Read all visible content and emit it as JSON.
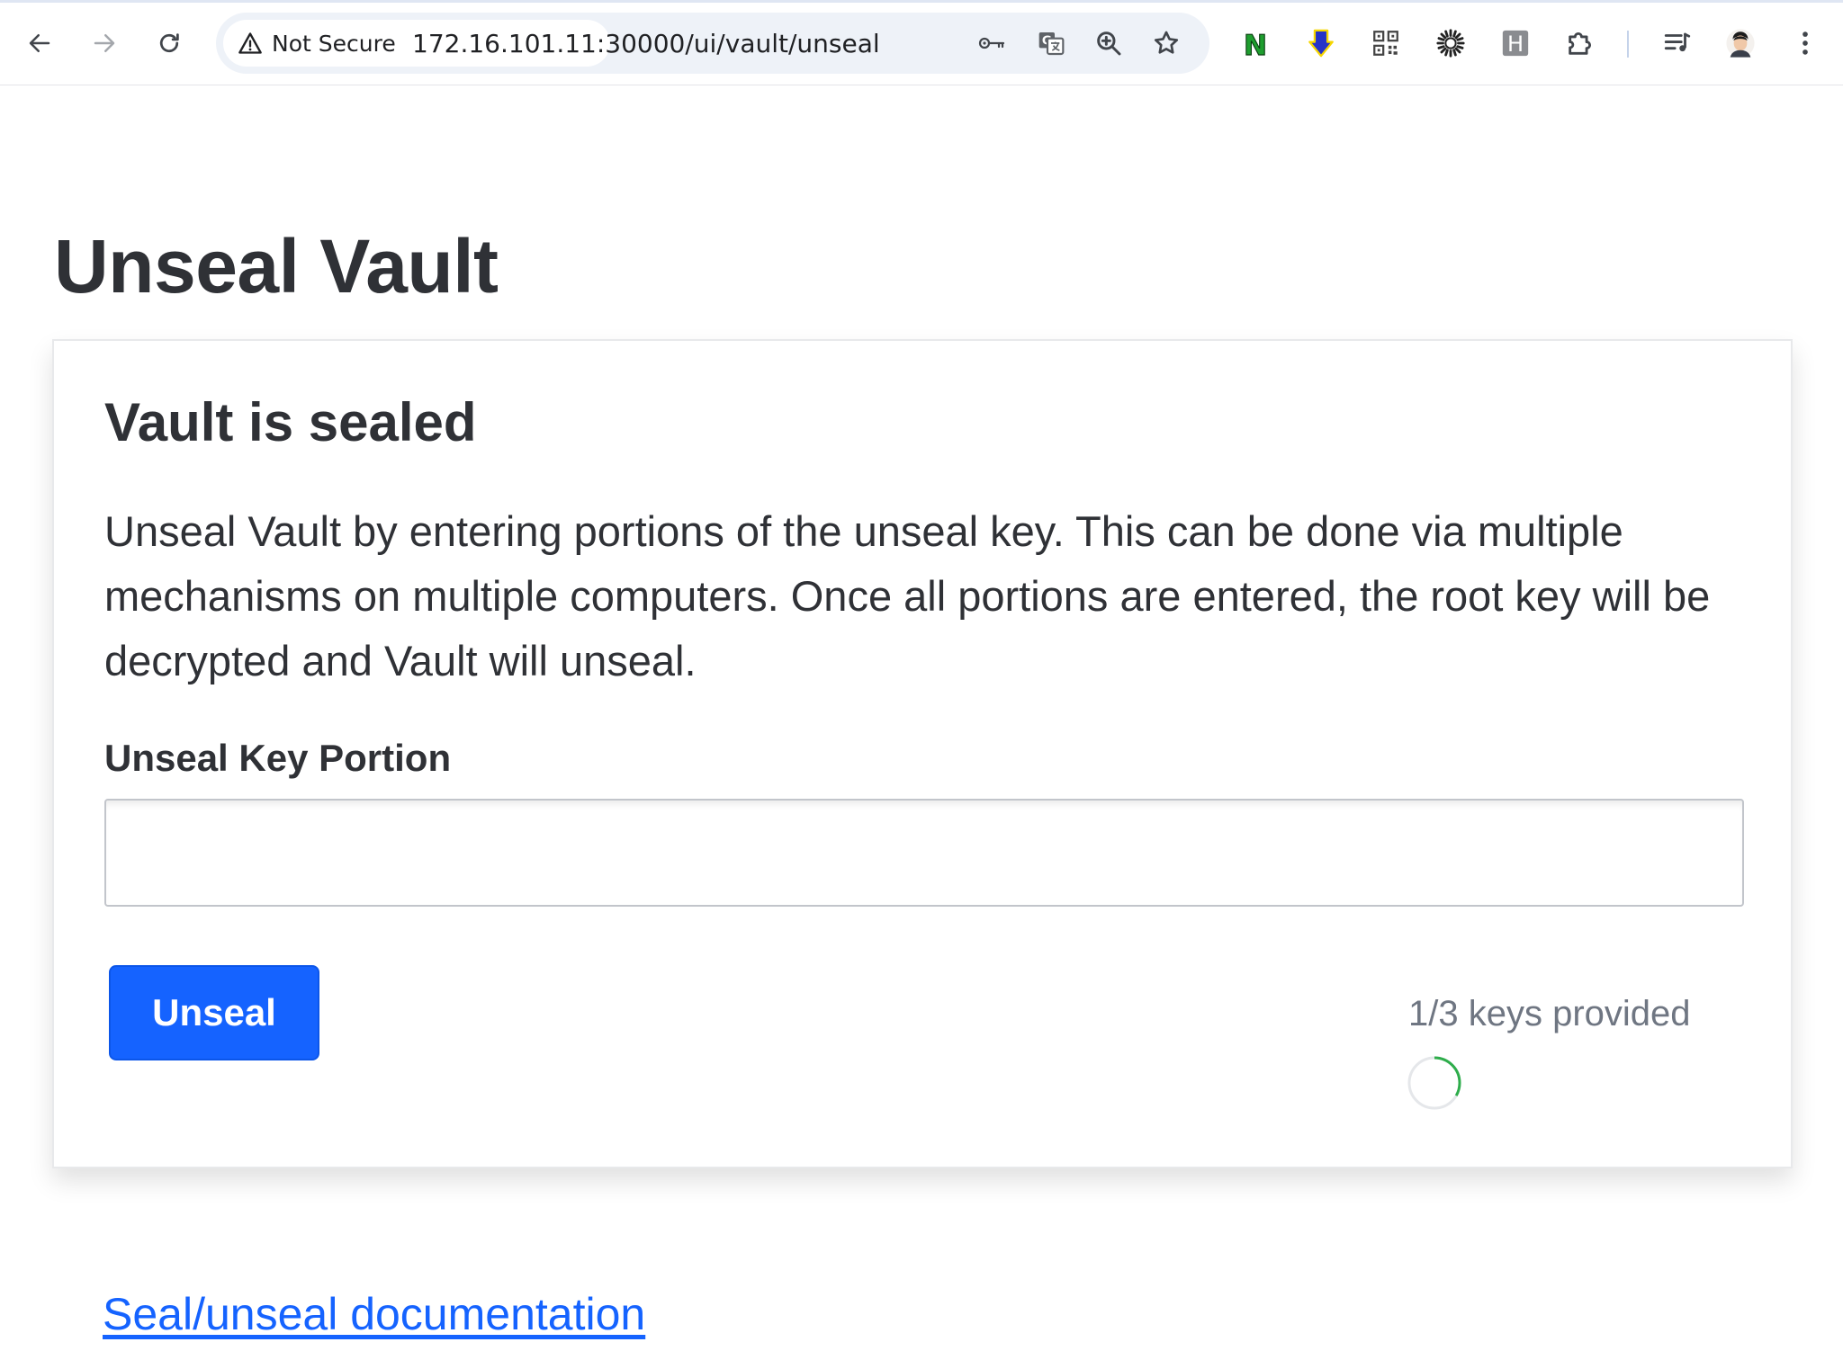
{
  "browser": {
    "security_label": "Not Secure",
    "url": "172.16.101.11:30000/ui/vault/unseal",
    "nav": [
      "back-icon",
      "forward-icon",
      "reload-icon"
    ],
    "omnibox_icons": [
      "key-icon",
      "translate-icon",
      "zoom-icon",
      "star-icon"
    ],
    "extensions": [
      {
        "icon": "n-extension-icon",
        "text": "N",
        "color": "#1e9e2f"
      },
      {
        "icon": "download-arrow-icon",
        "color": "#2633c8"
      },
      {
        "icon": "qr-code-icon"
      },
      {
        "icon": "sunburst-icon"
      },
      {
        "icon": "h-extension-icon",
        "text": "H"
      },
      {
        "icon": "puzzle-icon"
      },
      {
        "icon": "media-queue-icon"
      },
      {
        "icon": "profile-avatar-icon"
      },
      {
        "icon": "kebab-menu-icon"
      }
    ]
  },
  "page": {
    "title": "Unseal Vault",
    "card": {
      "title": "Vault is sealed",
      "description": "Unseal Vault by entering portions of the unseal key. This can be done via multiple mechanisms on multiple computers. Once all portions are entered, the root key will be decrypted and Vault will unseal.",
      "field_label": "Unseal Key Portion",
      "input_value": "",
      "button_label": "Unseal",
      "progress_text": "1/3 keys provided",
      "keys_provided": 1,
      "keys_required": 3
    },
    "doc_link": "Seal/unseal documentation"
  },
  "colors": {
    "accent": "#1563ff",
    "progress": "#2ead4b",
    "text": "#2f3136",
    "muted": "#6f7682"
  }
}
